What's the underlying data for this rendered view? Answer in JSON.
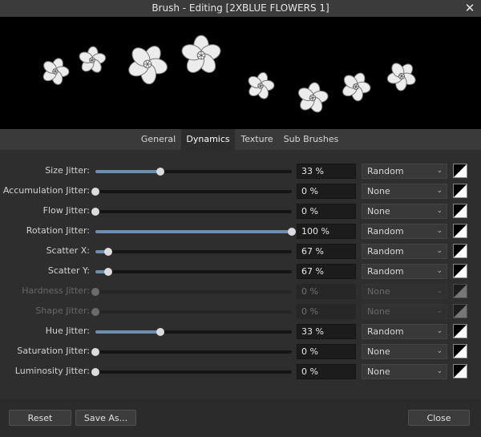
{
  "window": {
    "title": "Brush - Editing [2XBLUE FLOWERS 1]"
  },
  "icons": {
    "close": "close-icon",
    "flower": "flower-icon",
    "chevron": "chevron-down-icon",
    "curve": "pressure-curve-icon"
  },
  "tabs": [
    {
      "label": "General",
      "active": false
    },
    {
      "label": "Dynamics",
      "active": true
    },
    {
      "label": "Texture",
      "active": false
    },
    {
      "label": "Sub Brushes",
      "active": false
    }
  ],
  "rows": [
    {
      "label": "Size Jitter:",
      "value": "33 %",
      "fraction": 0.33,
      "mode": "Random",
      "enabled": true
    },
    {
      "label": "Accumulation Jitter:",
      "value": "0 %",
      "fraction": 0.0,
      "mode": "None",
      "enabled": true
    },
    {
      "label": "Flow Jitter:",
      "value": "0 %",
      "fraction": 0.0,
      "mode": "None",
      "enabled": true
    },
    {
      "label": "Rotation Jitter:",
      "value": "100 %",
      "fraction": 1.0,
      "mode": "Random",
      "enabled": true
    },
    {
      "label": "Scatter X:",
      "value": "67 %",
      "fraction": 0.067,
      "mode": "Random",
      "enabled": true
    },
    {
      "label": "Scatter Y:",
      "value": "67 %",
      "fraction": 0.067,
      "mode": "Random",
      "enabled": true
    },
    {
      "label": "Hardness Jitter:",
      "value": "0 %",
      "fraction": 0.0,
      "mode": "None",
      "enabled": false
    },
    {
      "label": "Shape Jitter:",
      "value": "0 %",
      "fraction": 0.0,
      "mode": "None",
      "enabled": false
    },
    {
      "label": "Hue Jitter:",
      "value": "33 %",
      "fraction": 0.33,
      "mode": "Random",
      "enabled": true
    },
    {
      "label": "Saturation Jitter:",
      "value": "0 %",
      "fraction": 0.0,
      "mode": "None",
      "enabled": true
    },
    {
      "label": "Luminosity Jitter:",
      "value": "0 %",
      "fraction": 0.0,
      "mode": "None",
      "enabled": true
    }
  ],
  "buttons": {
    "reset": "Reset",
    "save_as": "Save As...",
    "close": "Close"
  },
  "colors": {
    "accent": "#6e8eb0",
    "background": "#2e2e2e",
    "preview_bg": "#000000"
  }
}
